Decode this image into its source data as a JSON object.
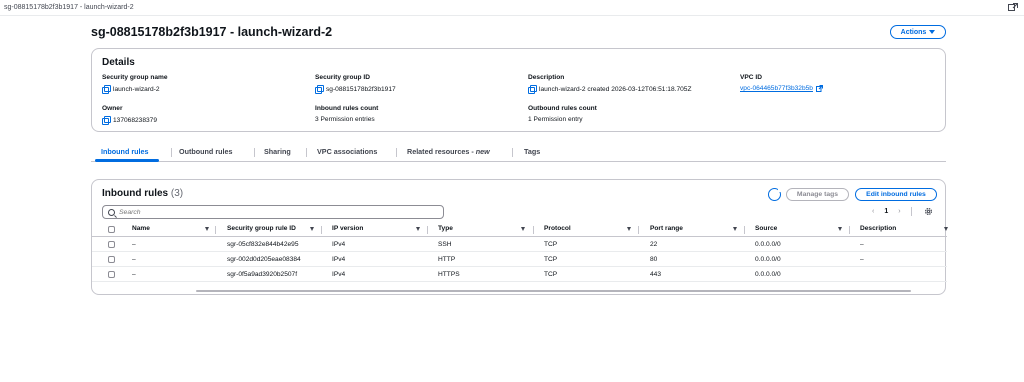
{
  "browser": {
    "tab_title": "sg-08815178b2f3b1917 - launch-wizard-2"
  },
  "header": {
    "title": "sg-08815178b2f3b1917 - launch-wizard-2",
    "actions_label": "Actions"
  },
  "details": {
    "heading": "Details",
    "fields": [
      {
        "label": "Security group name",
        "value": "launch-wizard-2"
      },
      {
        "label": "Security group ID",
        "value": "sg-08815178b2f3b1917"
      },
      {
        "label": "Description",
        "value": "launch-wizard-2 created 2026-03-12T06:51:18.705Z"
      },
      {
        "label": "VPC ID",
        "value": "vpc-064465b77f3b32b5b"
      },
      {
        "label": "Owner",
        "value": "137068238379"
      },
      {
        "label": "Inbound rules count",
        "value": "3 Permission entries"
      },
      {
        "label": "Outbound rules count",
        "value": "1 Permission entry"
      }
    ]
  },
  "tabs": [
    {
      "label": "Inbound rules",
      "active": true
    },
    {
      "label": "Outbound rules"
    },
    {
      "label": "Sharing"
    },
    {
      "label": "VPC associations"
    },
    {
      "label": "Related resources -",
      "suffix": "new"
    },
    {
      "label": "Tags"
    }
  ],
  "inbound": {
    "heading": "Inbound rules",
    "count": "(3)",
    "manage_tags_label": "Manage tags",
    "edit_label": "Edit inbound rules",
    "search_placeholder": "Search",
    "page": "1",
    "columns": [
      "Name",
      "Security group rule ID",
      "IP version",
      "Type",
      "Protocol",
      "Port range",
      "Source",
      "Description"
    ],
    "rows": [
      [
        "–",
        "sgr-05cf832e844b42e95",
        "IPv4",
        "SSH",
        "TCP",
        "22",
        "0.0.0.0/0",
        "–"
      ],
      [
        "–",
        "sgr-002d0d205eae08384",
        "IPv4",
        "HTTP",
        "TCP",
        "80",
        "0.0.0.0/0",
        "–"
      ],
      [
        "–",
        "sgr-0f5a9ad3920b2507f",
        "IPv4",
        "HTTPS",
        "TCP",
        "443",
        "0.0.0.0/0",
        "–"
      ]
    ]
  },
  "colors": {
    "accent": "#006ce0",
    "border": "#c6c6cd",
    "text": "#0f141a"
  },
  "icons": [
    "copy-icon",
    "external-link-icon",
    "refresh-icon",
    "search-icon",
    "settings-gear-icon",
    "sort-caret-icon",
    "caret-down-icon",
    "chevron-left-icon",
    "chevron-right-icon",
    "open-in-new-window-icon"
  ]
}
